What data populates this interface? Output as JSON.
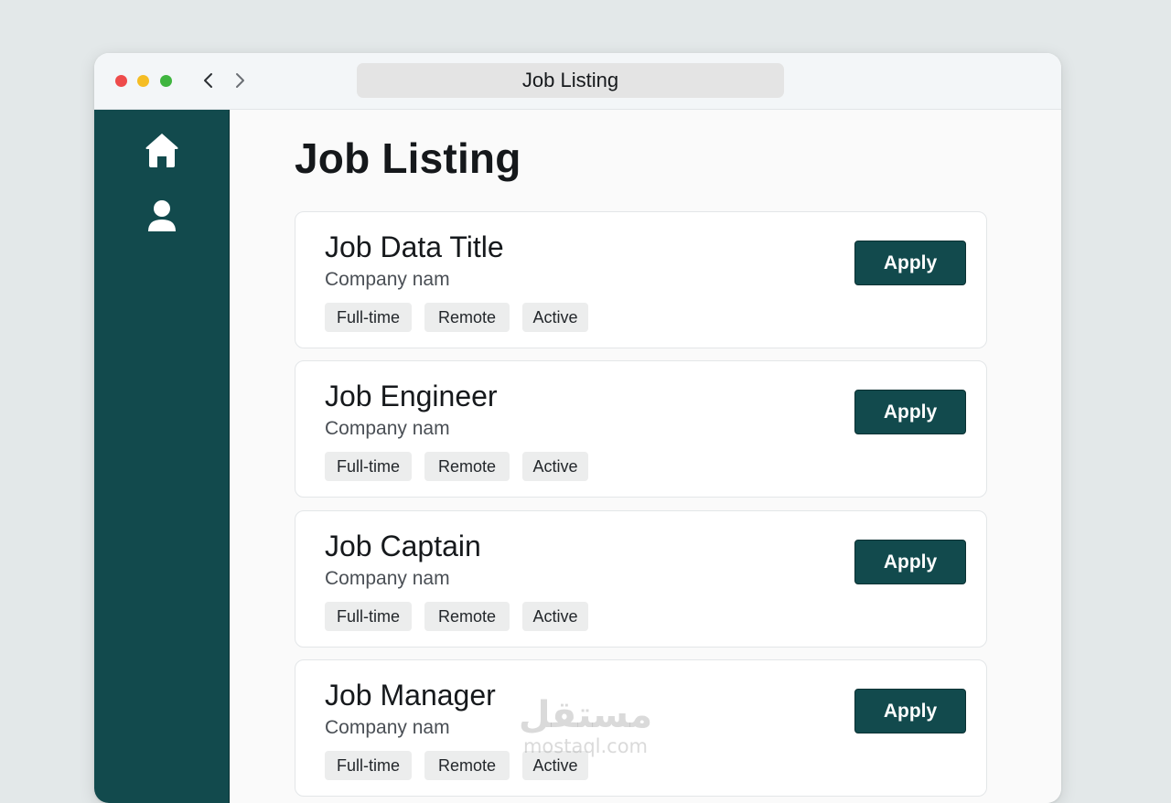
{
  "window": {
    "address_title": "Job Listing",
    "controls": [
      "close",
      "minimize",
      "maximize"
    ],
    "nav": {
      "back_icon": "chevron-left-icon",
      "forward_icon": "chevron-right-icon"
    }
  },
  "sidebar": {
    "items": [
      {
        "name": "home",
        "icon": "home-icon"
      },
      {
        "name": "profile",
        "icon": "user-icon"
      }
    ]
  },
  "main": {
    "title": "Job Listing",
    "jobs": [
      {
        "title": "Job Data Title",
        "company": "Company nam",
        "tags": [
          "Full-time",
          "Remote",
          "Active"
        ],
        "action": "Apply"
      },
      {
        "title": "Job Engineer",
        "company": "Company nam",
        "tags": [
          "Full-time",
          "Remote",
          "Active"
        ],
        "action": "Apply"
      },
      {
        "title": "Job Captain",
        "company": "Company nam",
        "tags": [
          "Full-time",
          "Remote",
          "Active"
        ],
        "action": "Apply"
      },
      {
        "title": "Job Manager",
        "company": "Company nam",
        "tags": [
          "Full-time",
          "Remote",
          "Active"
        ],
        "action": "Apply"
      }
    ]
  },
  "watermark": {
    "arabic": "مستقل",
    "latin": "mostaql.com"
  },
  "colors": {
    "accent": "#124a4d",
    "background": "#e3e8e9",
    "tag": "#eceded"
  }
}
